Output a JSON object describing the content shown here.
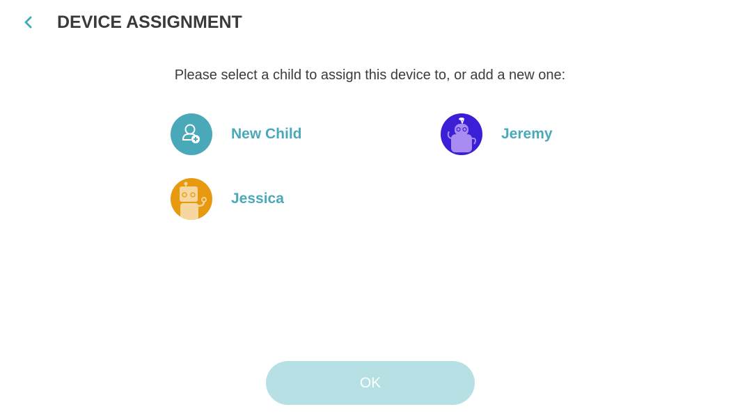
{
  "header": {
    "title": "DEVICE ASSIGNMENT",
    "back_icon": "chevron-left-icon"
  },
  "instruction": "Please select a child to assign this device to, or add a new one:",
  "children": [
    {
      "label": "New Child",
      "icon": "add-user-icon",
      "avatar_color": "#4aa9b9"
    },
    {
      "label": "Jeremy",
      "icon": "robot-avatar-purple",
      "avatar_color": "#3a1fd6"
    },
    {
      "label": "Jessica",
      "icon": "robot-avatar-orange",
      "avatar_color": "#e79a10"
    }
  ],
  "ok_button": {
    "label": "OK",
    "color": "#b6e0e3"
  },
  "colors": {
    "accent": "#4aa9b9",
    "title": "#3a3a3a"
  }
}
